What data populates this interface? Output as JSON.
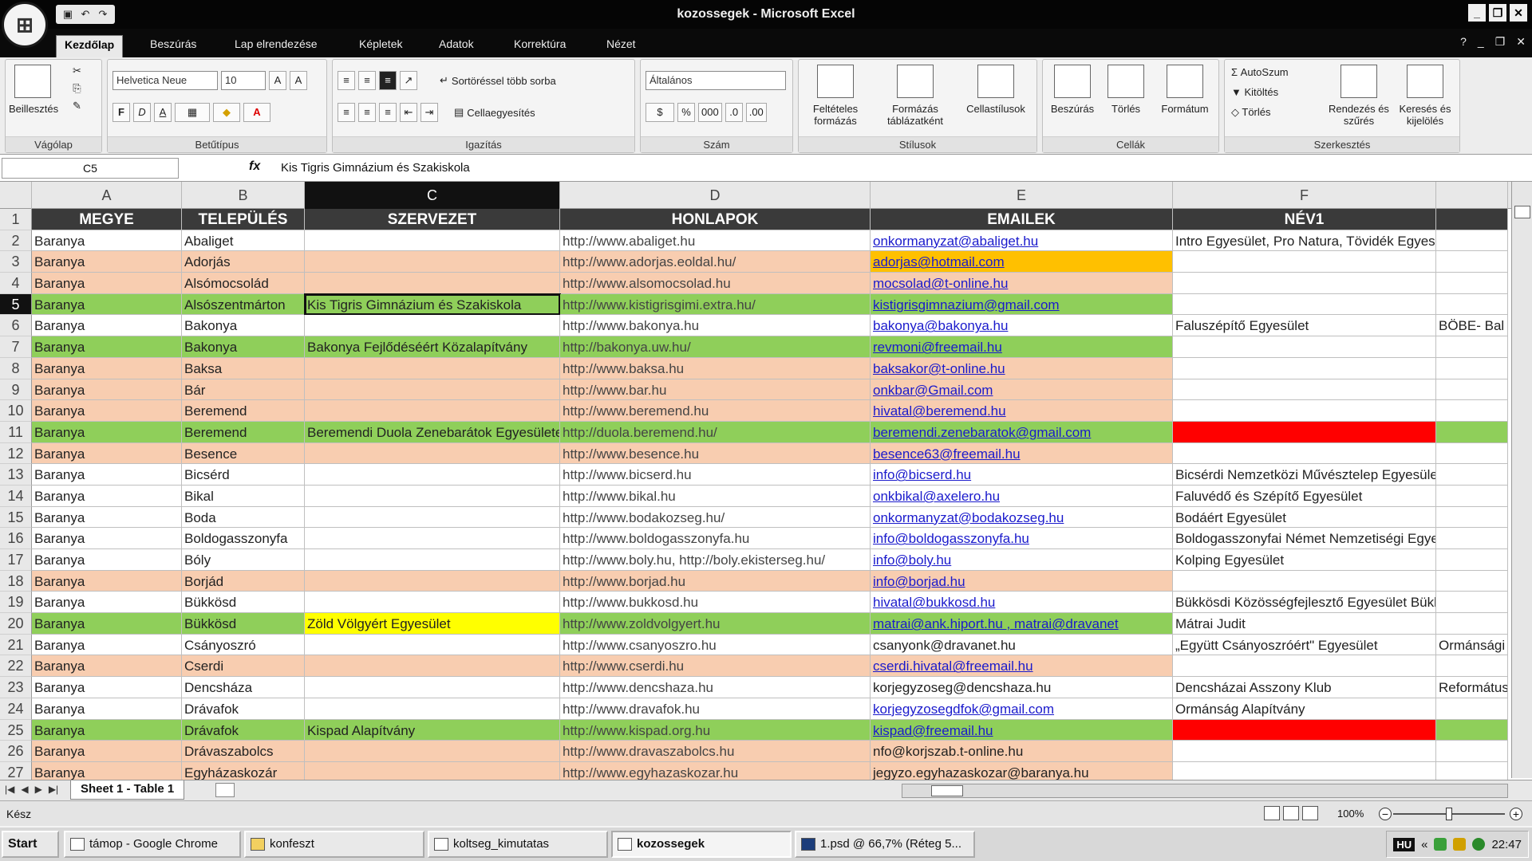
{
  "window": {
    "title": "kozossegek - Microsoft Excel"
  },
  "ribbon_tabs": [
    "Kezdőlap",
    "Beszúrás",
    "Lap elrendezése",
    "Képletek",
    "Adatok",
    "Korrektúra",
    "Nézet"
  ],
  "ribbon": {
    "clipboard": {
      "name": "Vágólap",
      "paste": "Beillesztés"
    },
    "font": {
      "name": "Betűtípus",
      "family": "Helvetica Neue",
      "size": "10",
      "bold": "F",
      "italic": "D",
      "underline": "A"
    },
    "alignment": {
      "name": "Igazítás",
      "wrap": "Sortöréssel több sorba",
      "merge": "Cellaegyesítés"
    },
    "number": {
      "name": "Szám",
      "format": "Általános"
    },
    "styles": {
      "name": "Stílusok",
      "cond": "Feltételes formázás",
      "table": "Formázás táblázatként",
      "cell": "Cellastílusok"
    },
    "cells": {
      "name": "Cellák",
      "insert": "Beszúrás",
      "delete": "Törlés",
      "format": "Formátum"
    },
    "editing": {
      "name": "Szerkesztés",
      "autosum": "AutoSzum",
      "fill": "Kitöltés",
      "clear": "Törlés",
      "sort": "Rendezés és szűrés",
      "find": "Keresés és kijelölés"
    }
  },
  "formula_bar": {
    "name_box": "C5",
    "fx": "fx",
    "content": "Kis Tigris Gimnázium és Szakiskola"
  },
  "columns": [
    "A",
    "B",
    "C",
    "D",
    "E",
    "F"
  ],
  "headers": [
    "MEGYE",
    "TELEPÜLÉS",
    "SZERVEZET",
    "HONLAPOK",
    "EMAILEK",
    "NÉV1",
    ""
  ],
  "rows": [
    {
      "n": "2",
      "a": "Baranya",
      "b": "Abaliget",
      "c": "",
      "d": "http://www.abaliget.hu",
      "e": "onkormanyzat@abaliget.hu",
      "f": "Intro Egyesület, Pro Natura, Tövidék Egyesület",
      "g": "",
      "color": "white",
      "elink": true
    },
    {
      "n": "3",
      "a": "Baranya",
      "b": "Adorjás",
      "c": "",
      "d": "http://www.adorjas.eoldal.hu/",
      "e": "adorjas@hotmail.com",
      "f": "",
      "g": "",
      "color": "peach",
      "ecolor": "orange",
      "elink": true
    },
    {
      "n": "4",
      "a": "Baranya",
      "b": "Alsómocsolád",
      "c": "",
      "d": "http://www.alsomocsolad.hu",
      "e": "mocsolad@t-online.hu",
      "f": "",
      "g": "",
      "color": "peach",
      "elink": true
    },
    {
      "n": "5",
      "a": "Baranya",
      "b": "Alsószentmárton",
      "c": "Kis Tigris Gimnázium és Szakiskola",
      "d": "http://www.kistigrisgimi.extra.hu/",
      "e": "kistigrisgimnazium@gmail.com",
      "f": "",
      "g": "",
      "color": "green",
      "elink": true,
      "sel": true
    },
    {
      "n": "6",
      "a": "Baranya",
      "b": "Bakonya",
      "c": "",
      "d": "http://www.bakonya.hu",
      "e": "bakonya@bakonya.hu",
      "f": "Faluszépítő Egyesület",
      "g": "BÖBE- Bal",
      "color": "white",
      "elink": true
    },
    {
      "n": "7",
      "a": "Baranya",
      "b": "Bakonya",
      "c": "Bakonya Fejlődéséért Közalapítvány",
      "d": "http://bakonya.uw.hu/",
      "e": "revmoni@freemail.hu",
      "f": "",
      "g": "",
      "color": "green",
      "elink": true
    },
    {
      "n": "8",
      "a": "Baranya",
      "b": "Baksa",
      "c": "",
      "d": "http://www.baksa.hu",
      "e": "baksakor@t-online.hu",
      "f": "",
      "g": "",
      "color": "peach",
      "elink": true
    },
    {
      "n": "9",
      "a": "Baranya",
      "b": "Bár",
      "c": "",
      "d": "http://www.bar.hu",
      "e": "onkbar@Gmail.com",
      "f": "",
      "g": "",
      "color": "peach",
      "elink": true
    },
    {
      "n": "10",
      "a": "Baranya",
      "b": "Beremend",
      "c": "",
      "d": "http://www.beremend.hu",
      "e": "hivatal@beremend.hu",
      "f": "",
      "g": "",
      "color": "peach",
      "elink": true
    },
    {
      "n": "11",
      "a": "Baranya",
      "b": "Beremend",
      "c": "Beremendi Duola Zenebarátok Egyesülete",
      "d": "http://duola.beremend.hu/",
      "e": "beremendi.zenebaratok@gmail.com",
      "f": "",
      "g": "",
      "color": "green",
      "fcolor": "red",
      "elink": true
    },
    {
      "n": "12",
      "a": "Baranya",
      "b": "Besence",
      "c": "",
      "d": "http://www.besence.hu",
      "e": "besence63@freemail.hu",
      "f": "",
      "g": "",
      "color": "peach",
      "elink": true
    },
    {
      "n": "13",
      "a": "Baranya",
      "b": "Bicsérd",
      "c": "",
      "d": "http://www.bicserd.hu",
      "e": "info@bicserd.hu",
      "f": "Bicsérdi Nemzetközi Művésztelep Egyesület,",
      "g": "",
      "color": "white",
      "elink": true
    },
    {
      "n": "14",
      "a": "Baranya",
      "b": "Bikal",
      "c": "",
      "d": "http://www.bikal.hu",
      "e": "onkbikal@axelero.hu",
      "f": "Faluvédő és Szépítő Egyesület",
      "g": "",
      "color": "white",
      "elink": true
    },
    {
      "n": "15",
      "a": "Baranya",
      "b": "Boda",
      "c": "",
      "d": " http://www.bodakozseg.hu/",
      "e": "onkormanyzat@bodakozseg.hu",
      "f": "Bodáért Egyesület",
      "g": "",
      "color": "white",
      "elink": true
    },
    {
      "n": "16",
      "a": "Baranya",
      "b": "Boldogasszonyfa",
      "c": "",
      "d": "http://www.boldogasszonyfa.hu",
      "e": "info@boldogasszonyfa.hu",
      "f": "Boldogasszonyfai Német Nemzetiségi Egyesü",
      "g": "",
      "color": "white",
      "elink": true
    },
    {
      "n": "17",
      "a": "Baranya",
      "b": "Bóly",
      "c": "",
      "d": "http://www.boly.hu, http://boly.ekisterseg.hu/",
      "e": "info@boly.hu",
      "f": "Kolping Egyesület",
      "g": "",
      "color": "white",
      "elink": true
    },
    {
      "n": "18",
      "a": "Baranya",
      "b": "Borjád",
      "c": "",
      "d": "http://www.borjad.hu",
      "e": " info@borjad.hu",
      "f": "",
      "g": "",
      "color": "peach",
      "elink": true
    },
    {
      "n": "19",
      "a": "Baranya",
      "b": "Bükkösd",
      "c": "",
      "d": "http://www.bukkosd.hu",
      "e": "hivatal@bukkosd.hu",
      "f": "Bükkösdi Közösségfejlesztő Egyesület Bükkös",
      "g": "",
      "color": "white",
      "elink": true
    },
    {
      "n": "20",
      "a": "Baranya",
      "b": "Bükkösd",
      "c": "Zöld Völgyért Egyesület",
      "d": "http://www.zoldvolgyert.hu",
      "e": "matrai@ank.hiport.hu , matrai@dravanet",
      "f": "Mátrai Judit",
      "g": "",
      "color": "green",
      "ccolor": "yellow",
      "elink": true
    },
    {
      "n": "21",
      "a": "Baranya",
      "b": "Csányoszró",
      "c": "",
      "d": "http://www.csanyoszro.hu",
      "e": "csanyonk@dravanet.hu",
      "f": "„Együtt Csányoszróért\" Egyesület",
      "g": "Ormánsági",
      "color": "white",
      "elink": false
    },
    {
      "n": "22",
      "a": "Baranya",
      "b": "Cserdi",
      "c": "",
      "d": "http://www.cserdi.hu",
      "e": "cserdi.hivatal@freemail.hu",
      "f": "",
      "g": "",
      "color": "peach",
      "elink": true
    },
    {
      "n": "23",
      "a": "Baranya",
      "b": "Dencsháza",
      "c": "",
      "d": "http://www.dencshaza.hu",
      "e": "korjegyzoseg@dencshaza.hu",
      "f": "Dencsházai Asszony Klub",
      "g": "Református",
      "color": "white",
      "elink": false
    },
    {
      "n": "24",
      "a": "Baranya",
      "b": "Drávafok",
      "c": "",
      "d": "http://www.dravafok.hu",
      "e": "korjegyzosegdfok@gmail.com",
      "f": "Ormánság Alapítvány",
      "g": "",
      "color": "white",
      "elink": true
    },
    {
      "n": "25",
      "a": "Baranya",
      "b": "Drávafok",
      "c": "Kispad Alapítvány",
      "d": "http://www.kispad.org.hu",
      "e": "kispad@freemail.hu",
      "f": "",
      "g": "",
      "color": "green",
      "fcolor": "red",
      "elink": true
    },
    {
      "n": "26",
      "a": "Baranya",
      "b": "Drávaszabolcs",
      "c": "",
      "d": "http://www.dravaszabolcs.hu",
      "e": "nfo@korjszab.t-online.hu",
      "f": "",
      "g": "",
      "color": "peach",
      "elink": false
    },
    {
      "n": "27",
      "a": "Baranya",
      "b": "Egyházaskozár",
      "c": "",
      "d": "http://www.egyhazaskozar.hu",
      "e": "jegyzo.egyhazaskozar@baranya.hu",
      "f": "",
      "g": "",
      "color": "peach",
      "elink": false
    }
  ],
  "sheet_tab": "Sheet 1 - Table 1",
  "status": {
    "text": "Kész",
    "zoom": "100%"
  },
  "taskbar": {
    "start": "Start",
    "items": [
      "támop - Google Chrome",
      "konfeszt",
      "koltseg_kimutatas",
      "kozossegek",
      "1.psd @ 66,7% (Réteg 5..."
    ],
    "lang": "HU",
    "clock": "22:47"
  },
  "colors": {
    "peach": "#f8cdb0",
    "green": "#8fcf5a",
    "orange": "#ffc000",
    "red": "#ff0000",
    "yellow": "#ffff00",
    "header": "#3a3a3a"
  }
}
